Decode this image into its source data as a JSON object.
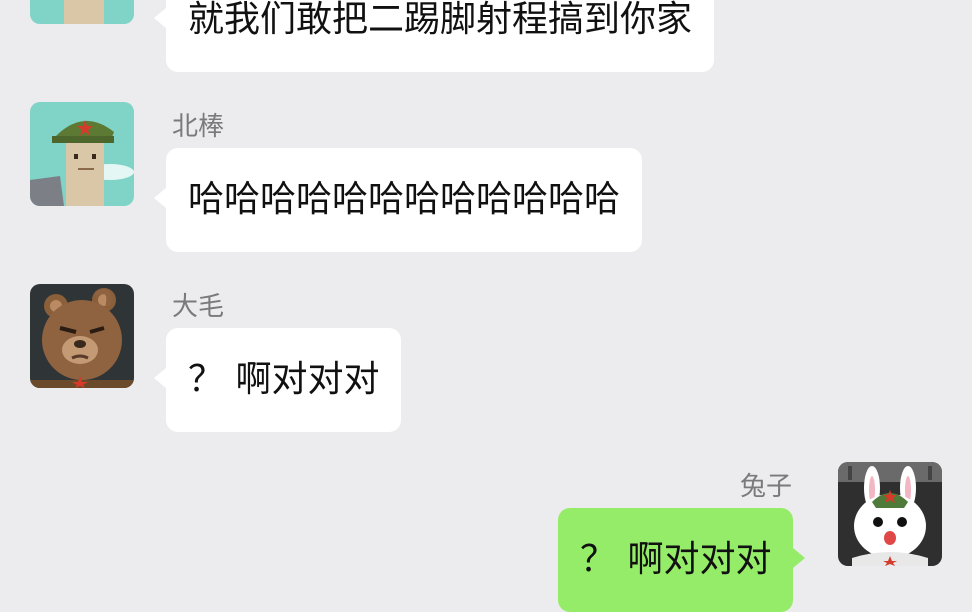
{
  "chat": {
    "messages": [
      {
        "sender": "",
        "text": "就我们敢把二踢脚射程搞到你家",
        "avatar": "soldier-character-avatar",
        "direction": "incoming"
      },
      {
        "sender": "北棒",
        "text": "哈哈哈哈哈哈哈哈哈哈哈哈",
        "avatar": "soldier-character-avatar",
        "direction": "incoming"
      },
      {
        "sender": "大毛",
        "text": "？ 啊对对对",
        "avatar": "bear-avatar",
        "direction": "incoming"
      },
      {
        "sender": "兔子",
        "text": "？ 啊对对对",
        "avatar": "rabbit-avatar",
        "direction": "outgoing"
      }
    ]
  },
  "colors": {
    "background": "#ecebee",
    "incoming_bubble": "#ffffff",
    "outgoing_bubble": "#95ec69",
    "sender_name": "#7a7a7a"
  }
}
